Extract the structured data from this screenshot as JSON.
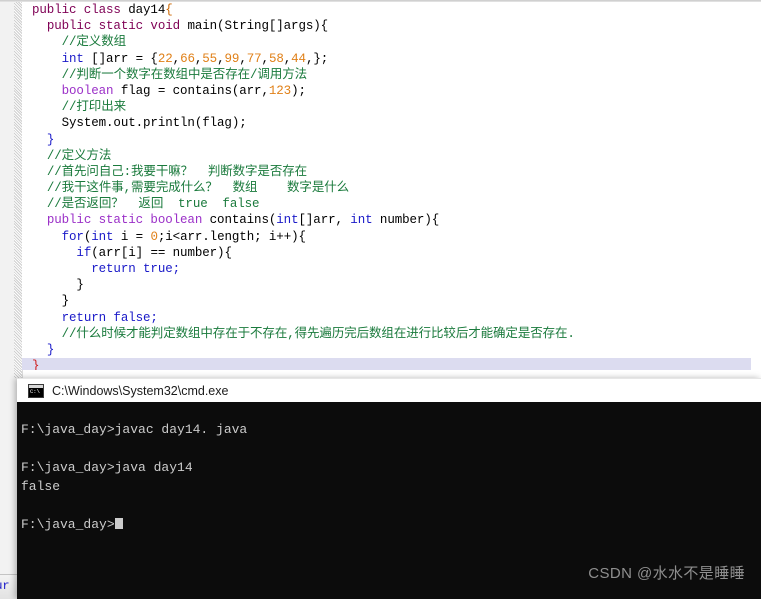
{
  "editor": {
    "status_text": "our",
    "code_lines": [
      {
        "indent": 0,
        "current": false,
        "tokens": [
          {
            "t": "public class ",
            "c": "kw-purple"
          },
          {
            "t": "day14",
            "c": "plain"
          },
          {
            "t": "{",
            "c": "brace"
          }
        ]
      },
      {
        "indent": 1,
        "current": false,
        "tokens": [
          {
            "t": "public static void ",
            "c": "kw-purple"
          },
          {
            "t": "main(String[]args){",
            "c": "plain"
          }
        ]
      },
      {
        "indent": 2,
        "current": false,
        "tokens": [
          {
            "t": "//定义数组",
            "c": "cmt"
          }
        ]
      },
      {
        "indent": 2,
        "current": false,
        "tokens": [
          {
            "t": "int ",
            "c": "kw-blue"
          },
          {
            "t": "[]arr = {",
            "c": "plain"
          },
          {
            "t": "22",
            "c": "num"
          },
          {
            "t": ",",
            "c": "plain"
          },
          {
            "t": "66",
            "c": "num"
          },
          {
            "t": ",",
            "c": "plain"
          },
          {
            "t": "55",
            "c": "num"
          },
          {
            "t": ",",
            "c": "plain"
          },
          {
            "t": "99",
            "c": "num"
          },
          {
            "t": ",",
            "c": "plain"
          },
          {
            "t": "77",
            "c": "num"
          },
          {
            "t": ",",
            "c": "plain"
          },
          {
            "t": "58",
            "c": "num"
          },
          {
            "t": ",",
            "c": "plain"
          },
          {
            "t": "44",
            "c": "num"
          },
          {
            "t": ",};",
            "c": "plain"
          }
        ]
      },
      {
        "indent": 2,
        "current": false,
        "tokens": [
          {
            "t": "//判断一个数字在数组中是否存在/调用方法",
            "c": "cmt"
          }
        ]
      },
      {
        "indent": 2,
        "current": false,
        "tokens": [
          {
            "t": "boolean ",
            "c": "kw-violet"
          },
          {
            "t": "flag = contains(arr,",
            "c": "plain"
          },
          {
            "t": "123",
            "c": "num"
          },
          {
            "t": ");",
            "c": "plain"
          }
        ]
      },
      {
        "indent": 2,
        "current": false,
        "tokens": [
          {
            "t": "//打印出来",
            "c": "cmt"
          }
        ]
      },
      {
        "indent": 2,
        "current": false,
        "tokens": [
          {
            "t": "System.out.println(flag);",
            "c": "plain"
          }
        ]
      },
      {
        "indent": 1,
        "current": false,
        "tokens": [
          {
            "t": "}",
            "c": "kw-blue"
          }
        ]
      },
      {
        "indent": 1,
        "current": false,
        "tokens": [
          {
            "t": "//定义方法",
            "c": "cmt"
          }
        ]
      },
      {
        "indent": 1,
        "current": false,
        "tokens": [
          {
            "t": "//首先问自己:我要干嘛？  判断数字是否存在",
            "c": "cmt"
          }
        ]
      },
      {
        "indent": 1,
        "current": false,
        "tokens": [
          {
            "t": "//我干这件事,需要完成什么？  数组    数字是什么",
            "c": "cmt"
          }
        ]
      },
      {
        "indent": 1,
        "current": false,
        "tokens": [
          {
            "t": "//是否返回？  返回  true  false",
            "c": "cmt"
          }
        ]
      },
      {
        "indent": 1,
        "current": false,
        "tokens": [
          {
            "t": "public static boolean ",
            "c": "kw-violet"
          },
          {
            "t": "contains(",
            "c": "plain"
          },
          {
            "t": "int",
            "c": "kw-blue"
          },
          {
            "t": "[]arr, ",
            "c": "plain"
          },
          {
            "t": "int",
            "c": "kw-blue"
          },
          {
            "t": " number){",
            "c": "plain"
          }
        ]
      },
      {
        "indent": 2,
        "current": false,
        "tokens": [
          {
            "t": "for",
            "c": "kw-blue"
          },
          {
            "t": "(",
            "c": "plain"
          },
          {
            "t": "int",
            "c": "kw-blue"
          },
          {
            "t": " i = ",
            "c": "plain"
          },
          {
            "t": "0",
            "c": "num"
          },
          {
            "t": ";i<arr.length; i++){",
            "c": "plain"
          }
        ]
      },
      {
        "indent": 3,
        "current": false,
        "tokens": [
          {
            "t": "if",
            "c": "kw-blue"
          },
          {
            "t": "(arr[i] == number){",
            "c": "plain"
          }
        ]
      },
      {
        "indent": 4,
        "current": false,
        "tokens": [
          {
            "t": "return true;",
            "c": "kw-blue"
          }
        ]
      },
      {
        "indent": 3,
        "current": false,
        "tokens": [
          {
            "t": "}",
            "c": "plain"
          }
        ]
      },
      {
        "indent": 2,
        "current": false,
        "tokens": [
          {
            "t": "}",
            "c": "plain"
          }
        ]
      },
      {
        "indent": 2,
        "current": false,
        "tokens": [
          {
            "t": "return false;",
            "c": "kw-blue"
          }
        ]
      },
      {
        "indent": 2,
        "current": false,
        "tokens": [
          {
            "t": "//什么时候才能判定数组中存在于不存在,得先遍历完后数组在进行比较后才能确定是否存在.",
            "c": "cmt"
          }
        ]
      },
      {
        "indent": 1,
        "current": false,
        "tokens": [
          {
            "t": "}",
            "c": "kw-blue"
          }
        ]
      },
      {
        "indent": 0,
        "current": true,
        "tokens": [
          {
            "t": "}",
            "c": "red-brace"
          }
        ]
      }
    ]
  },
  "cmd": {
    "title": "C:\\Windows\\System32\\cmd.exe",
    "icon": "console-icon",
    "lines": [
      "F:\\java_day>javac day14. java",
      "",
      "F:\\java_day>java day14",
      "false",
      "",
      "F:\\java_day>"
    ]
  },
  "watermark": {
    "text": "CSDN @水水不是睡睡"
  },
  "colors": {
    "keyword_purple": "#7f0055",
    "keyword_violet": "#9b30c8",
    "keyword_blue": "#1919c8",
    "number_orange": "#e08018",
    "comment_green": "#1a7a3c",
    "current_line": "#dcdcf0",
    "change_bar_red": "#d01c1c",
    "console_bg": "#0c0c0c",
    "console_fg": "#cccccc"
  }
}
